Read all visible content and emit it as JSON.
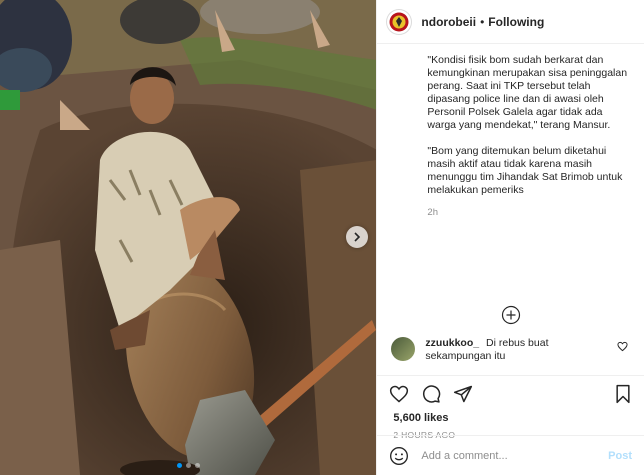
{
  "post": {
    "username": "ndorobeii",
    "separator": "•",
    "follow_label": "Following",
    "caption_paragraphs": [
      "\"Kondisi fisik bom sudah berkarat dan kemungkinan merupakan sisa peninggalan perang. Saat ini TKP tersebut telah dipasang police line dan di awasi oleh Personil Polsek Galela agar tidak ada warga yang mendekat,\" terang Mansur.",
      "\"Bom yang ditemukan belum diketahui masih aktif atau tidak karena masih menunggu tim Jihandak Sat Brimob untuk melakukan pemeriks"
    ],
    "caption_time": "2h",
    "comments": [
      {
        "user": "zzuukkoo_",
        "text": "Di rebus buat sekampungan itu"
      }
    ],
    "likes": "5,600 likes",
    "posted_ago": "2 HOURS AGO",
    "add_comment_placeholder": "Add a comment...",
    "post_button": "Post"
  },
  "photo": {
    "dot_count": 3,
    "active_dot": 0
  },
  "icons": {
    "avatar": "police-emblem-icon",
    "load_more": "plus-circle-icon",
    "like": "heart-icon",
    "comment": "comment-bubble-icon",
    "share": "paper-plane-icon",
    "save": "bookmark-icon",
    "emoji": "smiley-icon",
    "next": "chevron-right-icon"
  },
  "colors": {
    "accent": "#0095f6",
    "text": "#262626",
    "muted": "#8e8e8e",
    "post_disabled": "#b2dffc",
    "emblem": "#b8141b"
  }
}
